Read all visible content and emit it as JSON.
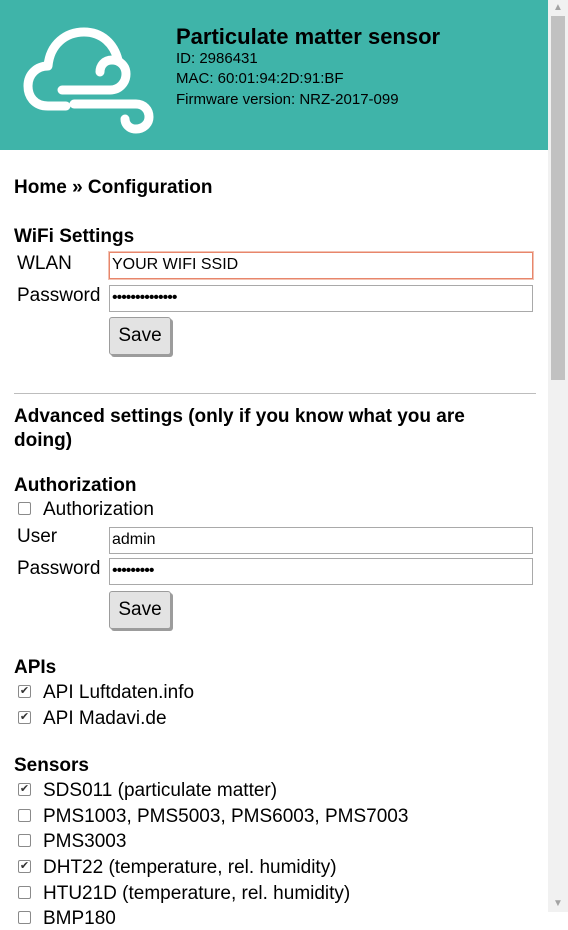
{
  "header": {
    "title": "Particulate matter sensor",
    "id": "ID: 2986431",
    "mac": "MAC: 60:01:94:2D:91:BF",
    "firmware": "Firmware version: NRZ-2017-099",
    "logo_icon": "cloud-wind-icon",
    "bg_color": "#3fb4a9"
  },
  "breadcrumb": "Home » Configuration",
  "wifi": {
    "heading": "WiFi Settings",
    "wlan_label": "WLAN",
    "wlan_value": "YOUR WIFI SSID",
    "password_label": "Password",
    "password_value": "••••••••••••••",
    "save_label": "Save"
  },
  "advanced": {
    "heading_line1": "Advanced settings (only if you know what you are",
    "heading_line2": "doing)"
  },
  "auth": {
    "heading": "Authorization",
    "checkbox_label": "Authorization",
    "checkbox_checked": false,
    "user_label": "User",
    "user_value": "admin",
    "password_label": "Password",
    "password_value": "•••••••••",
    "save_label": "Save"
  },
  "apis": {
    "heading": "APIs",
    "items": [
      {
        "label": "API Luftdaten.info",
        "checked": true
      },
      {
        "label": "API Madavi.de",
        "checked": true
      }
    ]
  },
  "sensors": {
    "heading": "Sensors",
    "items": [
      {
        "label": "SDS011 (particulate matter)",
        "checked": true
      },
      {
        "label": "PMS1003, PMS5003, PMS6003, PMS7003",
        "checked": false
      },
      {
        "label": "PMS3003",
        "checked": false
      },
      {
        "label": "DHT22 (temperature, rel. humidity)",
        "checked": true
      },
      {
        "label": "HTU21D (temperature, rel. humidity)",
        "checked": false
      },
      {
        "label": "BMP180",
        "checked": false
      }
    ]
  }
}
